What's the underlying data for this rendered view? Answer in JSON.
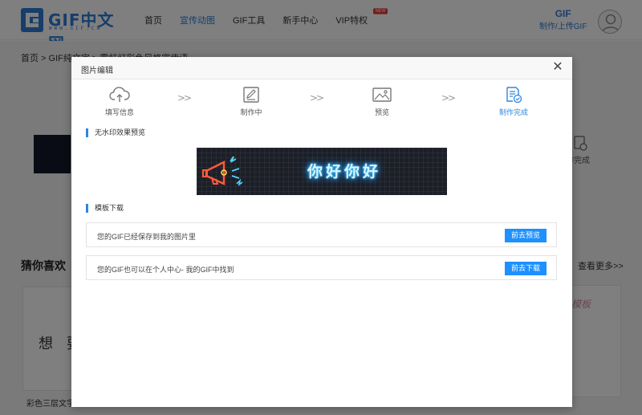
{
  "header": {
    "logo_text": "GIF中文网",
    "logo_sub": "WWW.GIF.CN",
    "nav": [
      {
        "label": "首页"
      },
      {
        "label": "宣传动图",
        "active": true
      },
      {
        "label": "GIF工具"
      },
      {
        "label": "新手中心"
      },
      {
        "label": "VIP特权",
        "badge": "NEW"
      }
    ],
    "upload_title": "GIF",
    "upload_sub": "制作/上传GIF",
    "accent": "#2e7bd6"
  },
  "page": {
    "breadcrumb": "首页 > GIF纯文字 > 霓虹灯彩色风格宣传语",
    "bg_step_label": "作完成",
    "guess_title": "猜你喜欢",
    "see_more": "查看更多>>",
    "card_left_text": "想 要",
    "card_left_caption": "彩色三层文字",
    "card_right_text": "模板"
  },
  "modal": {
    "title": "图片编辑",
    "close_icon": "close-icon",
    "steps": [
      {
        "label": "填写信息",
        "icon": "cloud-upload-icon"
      },
      {
        "label": "制作中",
        "icon": "edit-icon"
      },
      {
        "label": "预览",
        "icon": "image-icon"
      },
      {
        "label": "制作完成",
        "icon": "document-check-icon",
        "done": true
      }
    ],
    "arrow": ">>",
    "preview_section": "无水印效果预览",
    "banner_text": "你好你好",
    "download_section": "模板下载",
    "rows": [
      {
        "text": "您的GIF已经保存到我的图片里",
        "button": "前去预览"
      },
      {
        "text": "您的GIF也可以在个人中心- 我的GIF中找到",
        "button": "前去下载"
      }
    ],
    "button_color": "#1e90ff"
  }
}
